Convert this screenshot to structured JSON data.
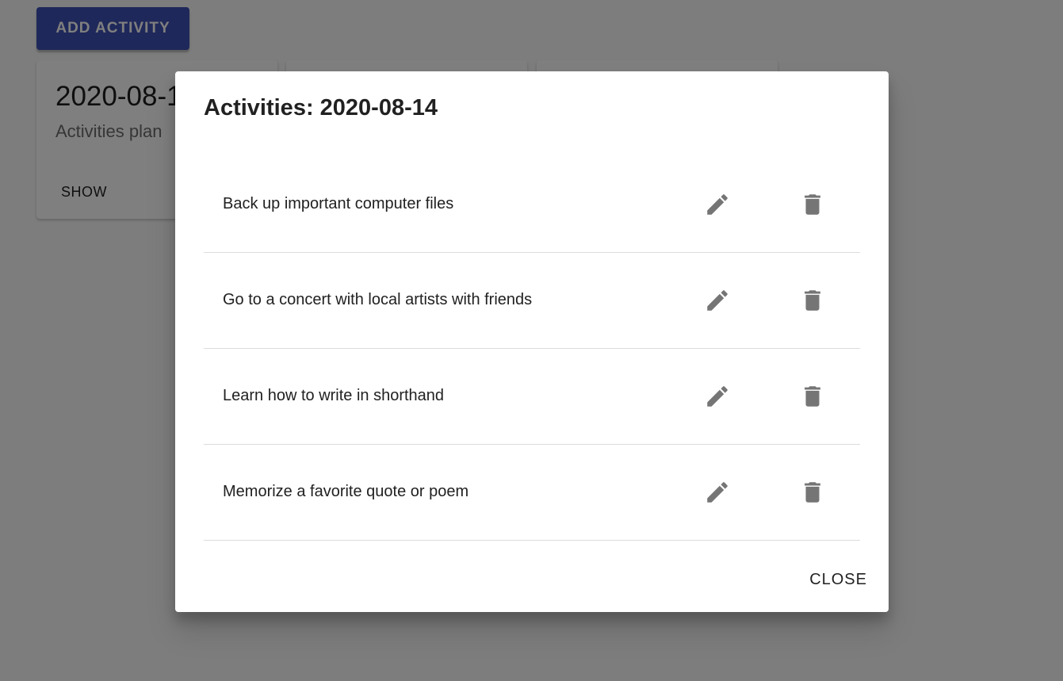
{
  "toolbar": {
    "add_label": "ADD ACTIVITY"
  },
  "cards": [
    {
      "date": "2020-08-1",
      "subtitle": "Activities plan",
      "show_label": "SHOW"
    },
    {
      "date": "",
      "subtitle": "",
      "show_label": ""
    },
    {
      "date": "",
      "subtitle": "",
      "show_label": ""
    }
  ],
  "dialog": {
    "title": "Activities: 2020-08-14",
    "items": [
      {
        "label": "Back up important computer files"
      },
      {
        "label": "Go to a concert with local artists with friends"
      },
      {
        "label": "Learn how to write in shorthand"
      },
      {
        "label": "Memorize a favorite quote or poem"
      }
    ],
    "edit_icon": "pencil-icon",
    "delete_icon": "trash-icon",
    "close_label": "CLOSE"
  },
  "colors": {
    "primary": "#3f51b5",
    "icon": "#757575",
    "backdrop": "rgba(0,0,0,0.5)"
  }
}
